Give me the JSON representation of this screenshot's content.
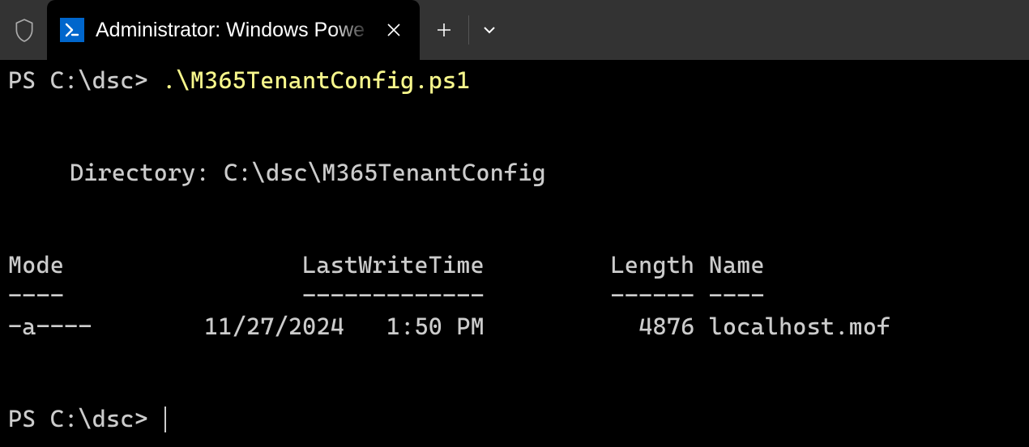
{
  "title_bar": {
    "tab_title": "Administrator: Windows Powe"
  },
  "terminal": {
    "prompt1": "PS C:\\dsc> ",
    "command": ".\\M365TenantConfig.ps1",
    "directory_label": "Directory: ",
    "directory_path": "C:\\dsc\\M365TenantConfig",
    "headers": {
      "mode": "Mode",
      "lastwrite": "LastWriteTime",
      "length": "Length",
      "name": "Name"
    },
    "separators": {
      "mode": "----",
      "lastwrite": "-------------",
      "length": "------",
      "name": "----"
    },
    "row": {
      "mode": "-a----",
      "date": "11/27/2024",
      "time": "1:50 PM",
      "length": "4876",
      "name": "localhost.mof"
    },
    "prompt2": "PS C:\\dsc> "
  }
}
